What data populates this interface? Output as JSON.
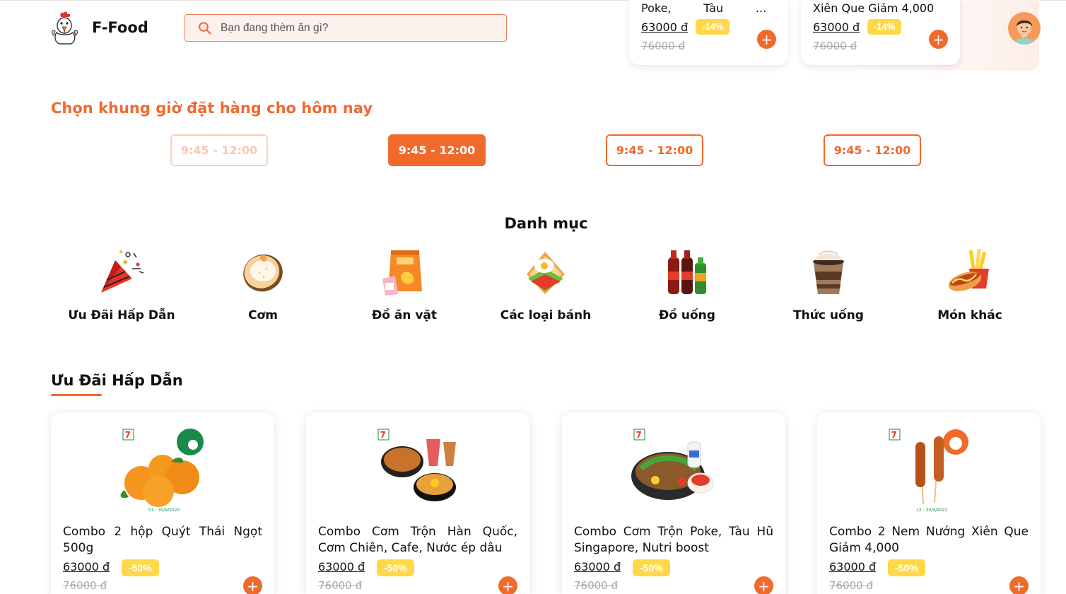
{
  "header": {
    "brand": "F-Food",
    "search_placeholder": "Bạn đang thèm ăn gì?"
  },
  "mini_cards": [
    {
      "name": "Poke,         Tàu         ...",
      "price": "63000 đ",
      "discount": "-14%",
      "old_price": "76000 đ"
    },
    {
      "name": "Xiên Que Giảm 4,000",
      "price": "63000 đ",
      "discount": "-14%",
      "old_price": "76000 đ"
    }
  ],
  "time_slots": {
    "title": "Chọn khung giờ đặt hàng cho hôm nay",
    "slots": [
      {
        "label": "9:45 - 12:00",
        "state": "disabled"
      },
      {
        "label": "9:45 - 12:00",
        "state": "active"
      },
      {
        "label": "9:45 - 12:00",
        "state": "available"
      },
      {
        "label": "9:45 - 12:00",
        "state": "available"
      }
    ]
  },
  "categories": {
    "title": "Danh mục",
    "items": [
      {
        "label": "Ưu Đãi Hấp Dẫn",
        "icon": "party-popper-icon"
      },
      {
        "label": "Cơm",
        "icon": "rice-bowl-icon"
      },
      {
        "label": "Đồ ăn vặt",
        "icon": "snack-bag-icon"
      },
      {
        "label": "Các loại bánh",
        "icon": "sandwich-icon"
      },
      {
        "label": "Đồ uống",
        "icon": "soda-bottles-icon"
      },
      {
        "label": "Thức uống",
        "icon": "milk-tea-icon"
      },
      {
        "label": "Món khác",
        "icon": "hotdog-fries-icon"
      }
    ]
  },
  "offers": {
    "title": "Ưu Đãi Hấp Dẫn",
    "products": [
      {
        "name": "Combo 2 hộp Quýt Thái Ngọt 500g",
        "price": "63000 đ",
        "discount": "-50%",
        "old_price": "76000 đ",
        "image": "tangerines-image"
      },
      {
        "name": "Combo Cơm Trộn Hàn Quốc, Cơm Chiên, Cafe, Nước ép dâu",
        "price": "63000 đ",
        "discount": "-50%",
        "old_price": "76000 đ",
        "image": "rice-combo-image"
      },
      {
        "name": "Combo Cơm Trộn Poke, Tàu Hũ Singapore, Nutri boost",
        "price": "63000 đ",
        "discount": "-50%",
        "old_price": "76000 đ",
        "image": "poke-bowl-image"
      },
      {
        "name": "Combo 2 Nem Nướng Xiên Que Giảm 4,000",
        "price": "63000 đ",
        "discount": "-50%",
        "old_price": "76000 đ",
        "image": "skewers-image"
      }
    ]
  },
  "colors": {
    "accent": "#f06a2b",
    "title_orange": "#ee6a31",
    "badge_yellow": "#ffd84a"
  }
}
